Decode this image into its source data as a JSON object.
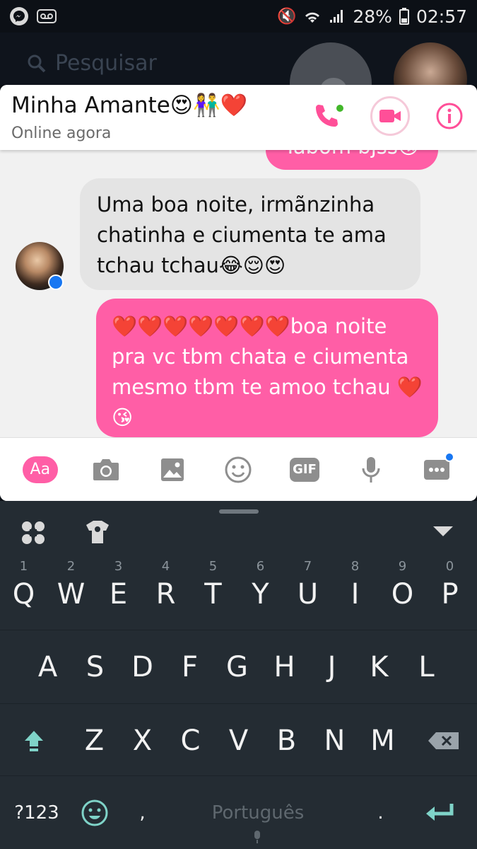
{
  "status_bar": {
    "battery": "28%",
    "time": "02:57"
  },
  "background_list": {
    "search_placeholder": "Pesquisar"
  },
  "chat": {
    "contact_name": "Minha Amante😍👫❤️",
    "presence": "Online agora",
    "messages": [
      {
        "direction": "outgoing",
        "text": "Tabom bjss😘"
      },
      {
        "direction": "incoming",
        "lines": [
          "Uma boa noite, irmãnzinha",
          "chatinha e ciumenta te ama",
          "tchau tchau😂😌😍"
        ]
      },
      {
        "direction": "outgoing",
        "lines": [
          "❤️❤️❤️❤️❤️❤️❤️boa noite",
          "pra vc tbm chata e ciumenta",
          "mesmo tbm te amoo tchau ❤️",
          "😘"
        ]
      }
    ],
    "composer": {
      "aa_label": "Aa",
      "gif_label": "GIF"
    }
  },
  "keyboard": {
    "row1": [
      {
        "key": "Q",
        "hint": "1"
      },
      {
        "key": "W",
        "hint": "2"
      },
      {
        "key": "E",
        "hint": "3"
      },
      {
        "key": "R",
        "hint": "4"
      },
      {
        "key": "T",
        "hint": "5"
      },
      {
        "key": "Y",
        "hint": "6"
      },
      {
        "key": "U",
        "hint": "7"
      },
      {
        "key": "I",
        "hint": "8"
      },
      {
        "key": "O",
        "hint": "9"
      },
      {
        "key": "P",
        "hint": "0"
      }
    ],
    "row2": [
      "A",
      "S",
      "D",
      "F",
      "G",
      "H",
      "J",
      "K",
      "L"
    ],
    "row3": [
      "Z",
      "X",
      "C",
      "V",
      "B",
      "N",
      "M"
    ],
    "symbols_label": "?123",
    "comma": ",",
    "period": ".",
    "space_label": "Português",
    "accent_color": "#7fd3c8"
  }
}
